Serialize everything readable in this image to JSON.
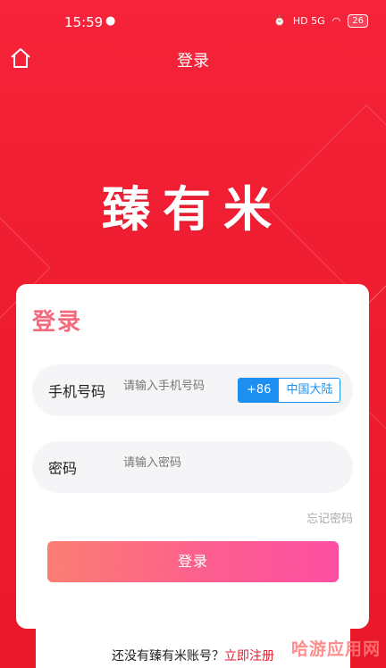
{
  "status_bar": {
    "time": "15:59",
    "wechat_icon": "wechat-icon",
    "network": "HD 5G",
    "battery": "26"
  },
  "nav": {
    "title": "登录",
    "home_icon": "home-icon"
  },
  "brand": {
    "name": "臻有米"
  },
  "card": {
    "title": "登录",
    "phone": {
      "label": "手机号码",
      "placeholder": "请输入手机号码",
      "country_code": "+86",
      "region": "中国大陆"
    },
    "password": {
      "label": "密码",
      "placeholder": "请输入密码"
    },
    "forgot": "忘记密码",
    "login_button": "登录"
  },
  "register": {
    "prompt": "还没有臻有米账号？",
    "link": "立即注册"
  },
  "watermark": "哈游应用网",
  "colors": {
    "background": "#f21f33",
    "accent": "#1d8ff0",
    "title": "#f26a7c",
    "button_start": "#fb7e72",
    "button_end": "#fe4fa3"
  }
}
